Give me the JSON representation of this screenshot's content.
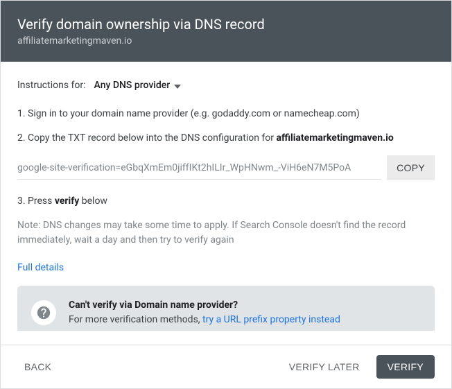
{
  "header": {
    "title": "Verify domain ownership via DNS record",
    "subtitle": "affiliatemarketingmaven.io"
  },
  "instructions": {
    "label": "Instructions for:",
    "provider": "Any DNS provider"
  },
  "steps": {
    "step1": "1. Sign in to your domain name provider (e.g. godaddy.com or namecheap.com)",
    "step2_prefix": "2. Copy the TXT record below into the DNS configuration for ",
    "step2_bold": "affiliatemarketingmaven.io",
    "txt_value": "google-site-verification=eGbqXmEm0jiffIKt2hILIr_WpHNwm_-ViH6eN7M5PoA",
    "copy_label": "COPY",
    "step3_prefix": "3. Press ",
    "step3_bold": "verify",
    "step3_suffix": " below",
    "note": "Note: DNS changes may take some time to apply. If Search Console doesn't find the record immediately, wait a day and then try to verify again",
    "full_details": "Full details"
  },
  "help": {
    "title": "Can't verify via Domain name provider?",
    "text_prefix": "For more verification methods, ",
    "link": "try a URL prefix property instead"
  },
  "footer": {
    "back": "BACK",
    "verify_later": "VERIFY LATER",
    "verify": "VERIFY"
  }
}
